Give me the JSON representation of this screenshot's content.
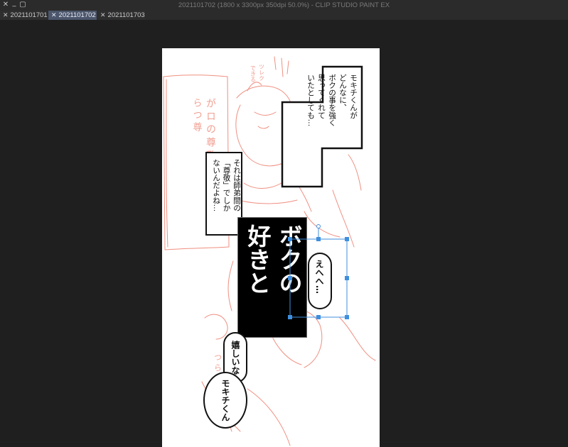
{
  "window": {
    "title": "2021101702 (1800 x 3300px 350dpi 50.0%)  - CLIP STUDIO PAINT EX",
    "close_glyph": "✕",
    "minimize_glyph": "_",
    "maximize_glyph": "▢"
  },
  "tabs": [
    {
      "label": "2021101701",
      "close": "✕",
      "active": false
    },
    {
      "label": "2021101702",
      "close": "✕",
      "active": true
    },
    {
      "label": "2021101703",
      "close": "✕",
      "active": false
    }
  ],
  "canvas": {
    "narration_1": "モキチくんが\nどんなに、\nボクの事を強く\n思ってくれて\nいたとしても…",
    "narration_2": "それは師弟間の\n「尊敬」でしか\nないんだよね…",
    "title_text": "ボクの\n好きと",
    "bubble_ehehe": "えへへ…",
    "bubble_ureshii": "嬉しいな",
    "bubble_mokichi": "モキチくん",
    "sketch_notes_a": "ガロの\n尊敬",
    "sketch_notes_b": "ツレクが\nできる"
  },
  "colors": {
    "sketch": "#ef8f80",
    "selection": "#3f8fde",
    "active_tab": "#4b556b"
  }
}
